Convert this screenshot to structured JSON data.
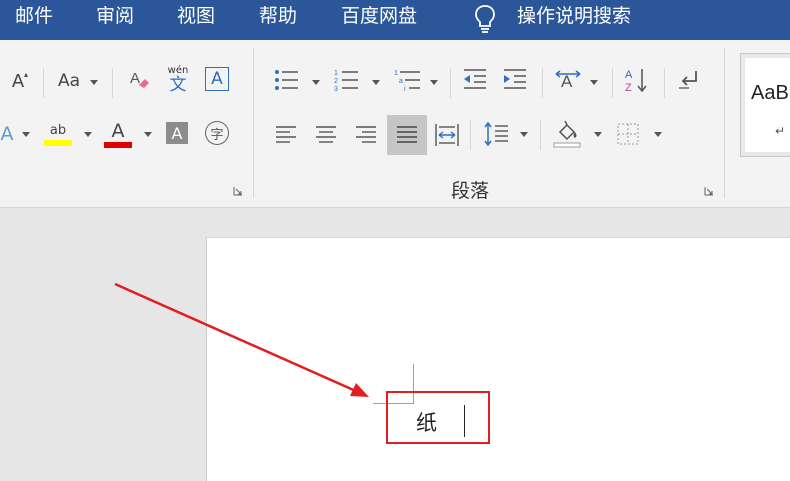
{
  "tabs": [
    "邮件",
    "审阅",
    "视图",
    "帮助",
    "百度网盘"
  ],
  "tell_me": {
    "label": "操作说明搜索",
    "icon": "lightbulb-icon"
  },
  "ribbon": {
    "font_group": {
      "change_case_label": "Aa",
      "phonetic_small": "wén",
      "phonetic_char": "文",
      "char_border_letter": "A",
      "font_color_letter": "A",
      "char_shading_letter": "A",
      "highlight_letters": "ab",
      "enclose_char": "字",
      "grow_font_letter": "A",
      "text_effects_letter": "A",
      "highlight_color": "#ffff00",
      "font_color": "#e00000"
    },
    "paragraph_group": {
      "label": "段落"
    },
    "styles_group": {
      "preview": "AaB",
      "para_mark": "↵"
    }
  },
  "document": {
    "text": "纸"
  },
  "colors": {
    "tab_bar": "#2b579a",
    "annotation": "#e02020"
  }
}
